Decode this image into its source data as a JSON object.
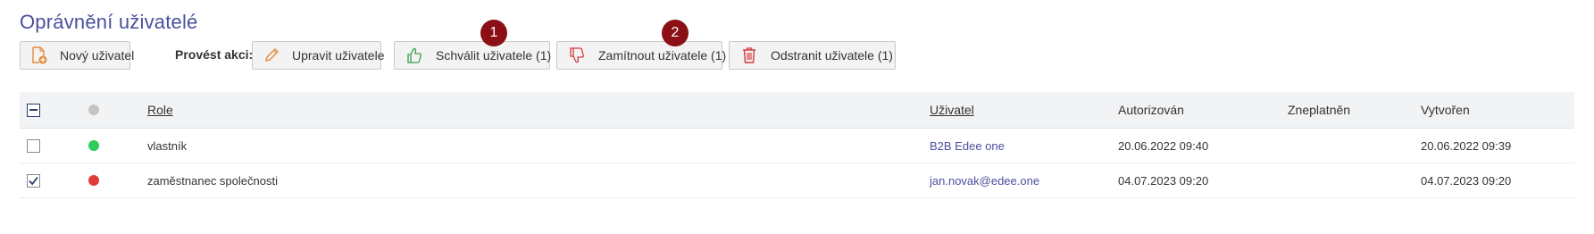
{
  "page": {
    "title": "Oprávnění uživatelé"
  },
  "toolbar": {
    "new_user_label": "Nový uživatel",
    "actions_label": "Provést akci:",
    "edit_label": "Upravit uživatele",
    "approve_label": "Schválit uživatele (1)",
    "reject_label": "Zamítnout uživatele (1)",
    "delete_label": "Odstranit uživatele (1)"
  },
  "annotations": {
    "badge1": "1",
    "badge2": "2"
  },
  "table": {
    "columns": {
      "role": "Role",
      "user": "Uživatel",
      "authorized": "Autorizován",
      "invalidated": "Zneplatněn",
      "created": "Vytvořen"
    },
    "rows": [
      {
        "checked": false,
        "status_color": "#2ecc5a",
        "role": "vlastník",
        "user": "B2B Edee one",
        "authorized": "20.06.2022 09:40",
        "invalidated": "",
        "created": "20.06.2022 09:39"
      },
      {
        "checked": true,
        "status_color": "#e03c3c",
        "role": "zaměstnanec společnosti",
        "user": "jan.novak@edee.one",
        "authorized": "04.07.2023 09:20",
        "invalidated": "",
        "created": "04.07.2023 09:20"
      }
    ]
  },
  "colors": {
    "title": "#4a4f9c",
    "badge": "#8b0f14",
    "status_header": "#c4c4c4",
    "status_active": "#2ecc5a",
    "status_inactive": "#e03c3c",
    "icon_orange": "#e58a3a",
    "icon_green": "#3aa04a",
    "icon_red": "#d33a3a"
  },
  "icons": {
    "new_user": "add-document-icon",
    "edit": "pencil-icon",
    "approve": "thumbs-up-icon",
    "reject": "thumbs-down-icon",
    "delete": "trash-icon",
    "select_all": "indeterminate-checkbox-icon",
    "status": "status-dot-icon"
  }
}
